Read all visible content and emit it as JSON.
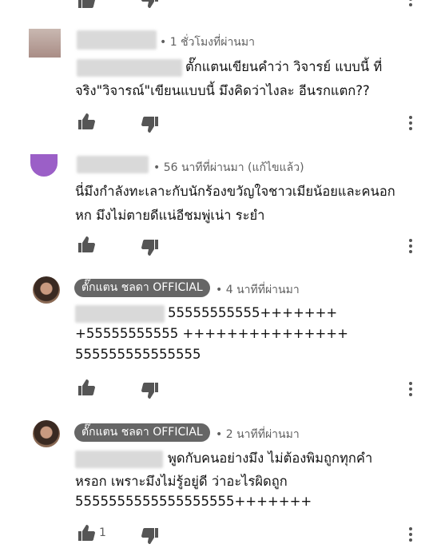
{
  "colors": {
    "chip_bg": "#666666",
    "meta": "#606060",
    "text": "#111111",
    "icon": "#555555"
  },
  "comments": [
    {
      "author": "",
      "time": "• 1 ชั่วโมงที่ผ่านมา",
      "line1": "ตั๊กแตนเขียนคำว่า วิจารย์  แบบนี้  ที่",
      "line2": "จริง\"วิจารณ์\"เขียนแบบนี้ มึงคิดว่าไงละ อีนรกแตก??",
      "likes": ""
    },
    {
      "author": "",
      "time": "• 56 นาทีที่ผ่านมา (แก้ไขแล้ว)",
      "line1": "นี่มึงกำลังทะเลาะกับนักร้องขวัญใจชาวเมียน้อยและคนอก",
      "line2": "หก  มึงไม่ตายดีแน่อีชมพู่เน่า ระยำ",
      "likes": ""
    },
    {
      "author": "ตั๊กแตน ชลดา OFFICIAL",
      "time": "• 4 นาทีที่ผ่านมา",
      "line1": "55555555555+++++++",
      "line2": "+55555555555 +++++++++++++++",
      "line3": "555555555555555",
      "likes": ""
    },
    {
      "author": "ตั๊กแตน ชลดา OFFICIAL",
      "time": "• 2 นาทีที่ผ่านมา",
      "line1": "พูดกับคนอย่างมึง ไม่ต้องพิมถูกทุกคำ",
      "line2": "หรอก เพราะมึงไม่รู้อยู่ดี ว่าอะไรผิดถูก",
      "line3": "5555555555555555555+++++++",
      "likes": "1"
    }
  ]
}
